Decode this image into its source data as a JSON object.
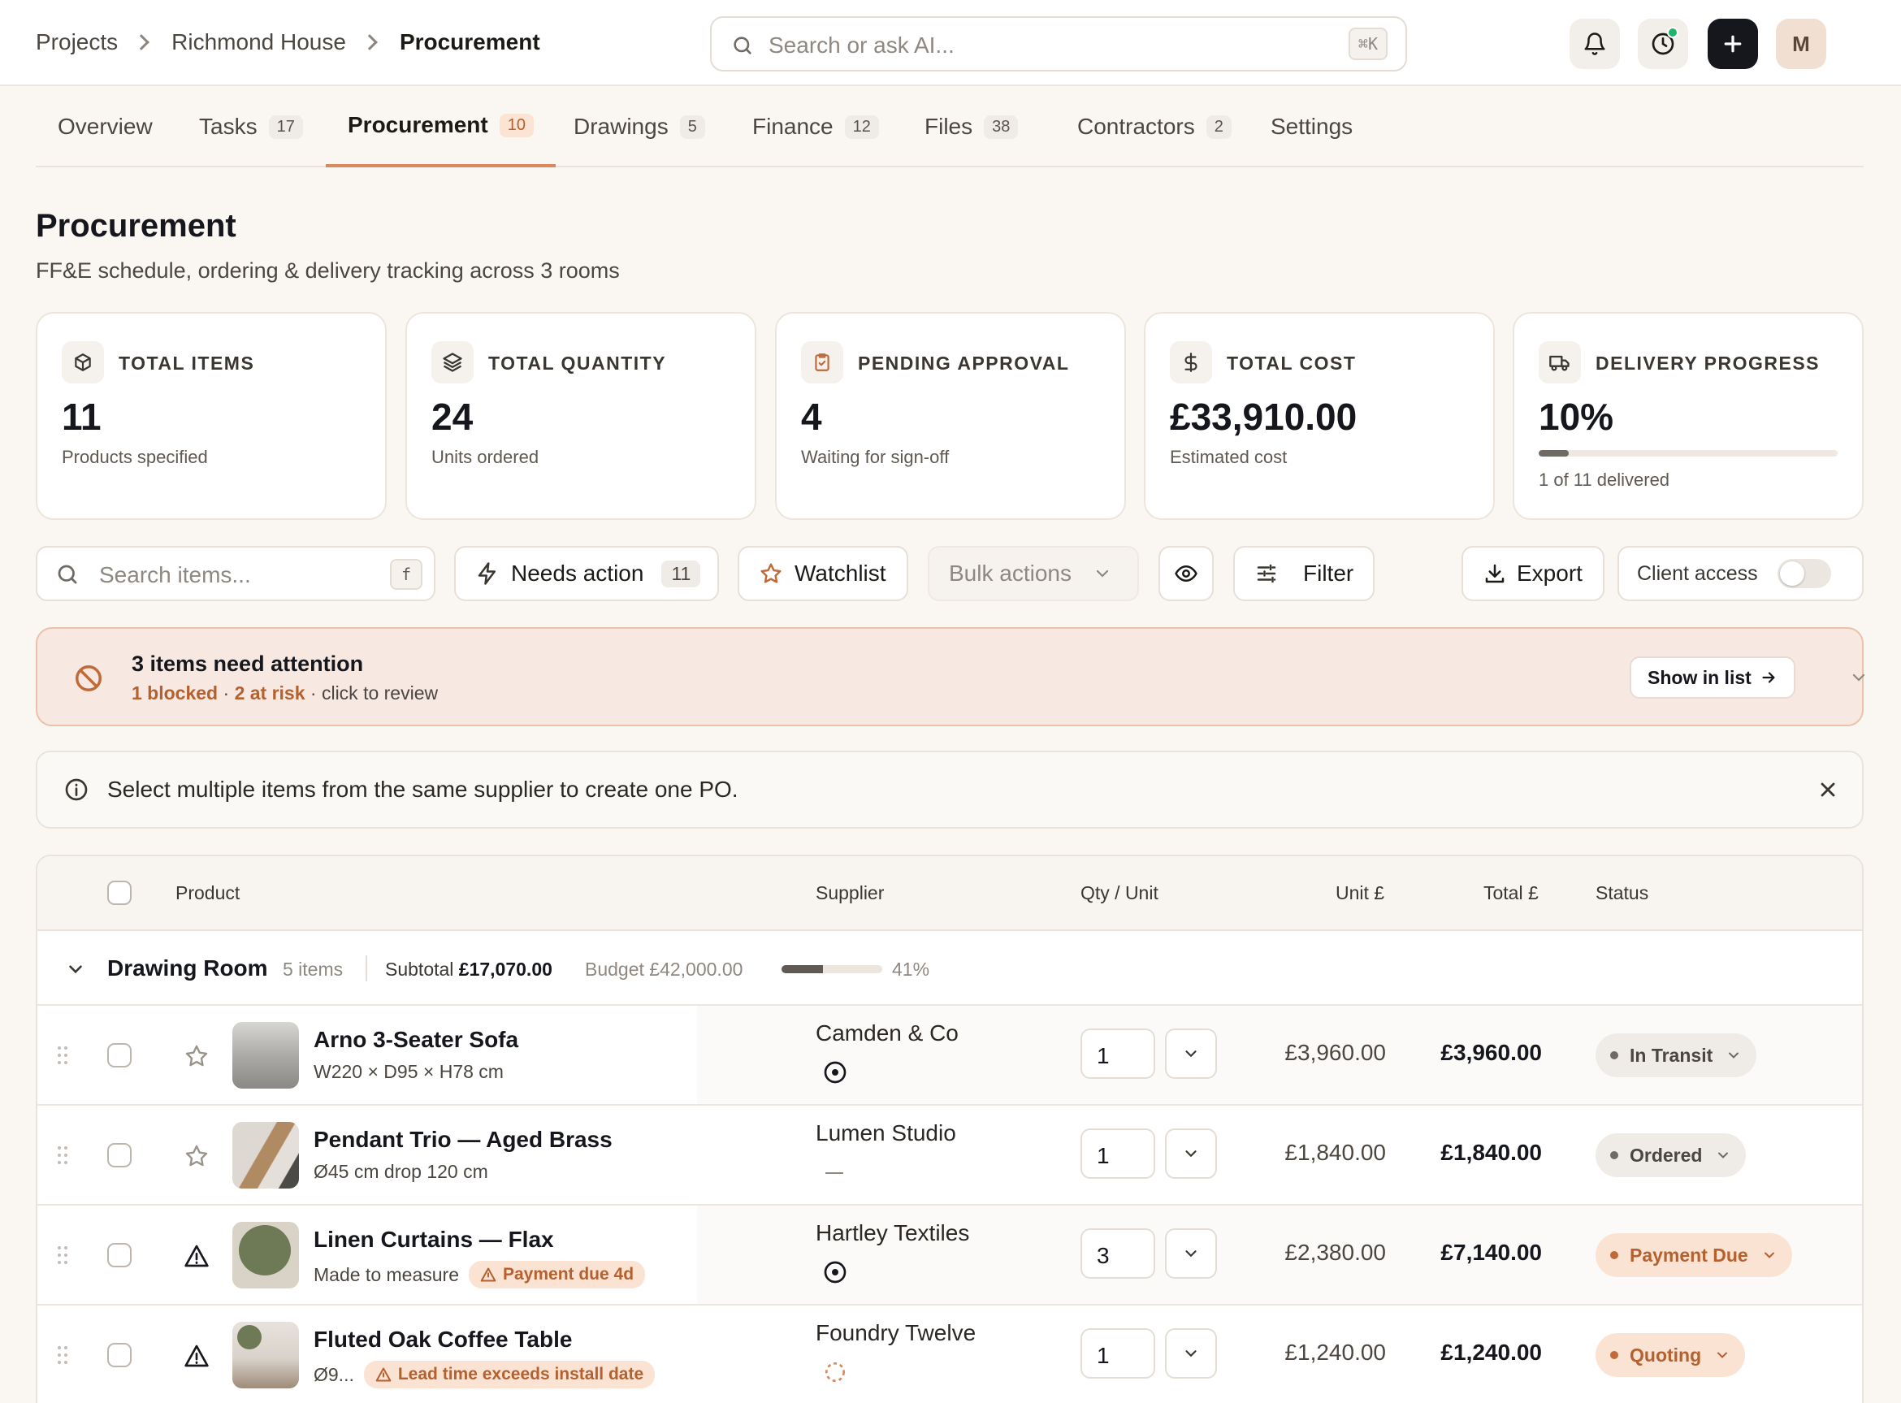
{
  "breadcrumbs": [
    "Projects",
    "Richmond House",
    "Procurement"
  ],
  "search": {
    "placeholder": "Search or ask AI...",
    "shortcut": "⌘K"
  },
  "user": {
    "initial": "M"
  },
  "tabs": [
    {
      "label": "Overview",
      "count": ""
    },
    {
      "label": "Tasks",
      "count": "17"
    },
    {
      "label": "Procurement",
      "count": "10"
    },
    {
      "label": "Drawings",
      "count": "5"
    },
    {
      "label": "Finance",
      "count": "12"
    },
    {
      "label": "Files",
      "count": "38"
    },
    {
      "label": "Contractors",
      "count": "2"
    },
    {
      "label": "Settings",
      "count": ""
    }
  ],
  "page": {
    "title": "Procurement",
    "subtitle": "FF&E schedule, ordering & delivery tracking across 3 rooms"
  },
  "kpis": [
    {
      "label": "TOTAL ITEMS",
      "value": "11",
      "sub": "Products specified",
      "icon": "package-icon"
    },
    {
      "label": "TOTAL QUANTITY",
      "value": "24",
      "sub": "Units ordered",
      "icon": "layers-icon"
    },
    {
      "label": "PENDING APPROVAL",
      "value": "4",
      "sub": "Waiting for sign-off",
      "icon": "clipboard-check-icon"
    },
    {
      "label": "TOTAL COST",
      "value": "£33,910.00",
      "sub": "Estimated cost",
      "icon": "dollar-icon"
    },
    {
      "label": "DELIVERY PROGRESS",
      "value": "10%",
      "sub": "1 of 11 delivered",
      "icon": "truck-icon",
      "progress": 0.1
    }
  ],
  "toolbar": {
    "search_placeholder": "Search items...",
    "search_shortcut": "f",
    "needs_action_label": "Needs action",
    "needs_action_count": "11",
    "watchlist_label": "Watchlist",
    "bulk_label": "Bulk actions",
    "filter_label": "Filter",
    "export_label": "Export",
    "client_access_label": "Client access",
    "client_access_on": false
  },
  "alert": {
    "title": "3 items need attention",
    "blocked": "1 blocked",
    "sep": "·",
    "at_risk": "2 at risk",
    "suffix": "· click to review",
    "button": "Show in list"
  },
  "info": {
    "text": "Select multiple items from the same supplier to create one PO."
  },
  "table": {
    "headers": {
      "product": "Product",
      "supplier": "Supplier",
      "qty": "Qty / Unit",
      "unit": "Unit £",
      "total": "Total £",
      "status": "Status"
    },
    "group": {
      "name": "Drawing Room",
      "items": "5 items",
      "subtotal_label": "Subtotal",
      "subtotal": "£17,070.00",
      "budget": "Budget £42,000.00",
      "pct_label": "41%",
      "pct": 0.41
    },
    "rows": [
      {
        "name": "Arno 3-Seater Sofa",
        "desc": "W220 × D95 × H78 cm",
        "warning": "",
        "supplier": "Camden & Co",
        "qty": "1",
        "unit": "£3,960.00",
        "total": "£3,960.00",
        "status": "In Transit",
        "status_kind": "neutral",
        "flag": "star"
      },
      {
        "name": "Pendant Trio — Aged Brass",
        "desc": "Ø45 cm drop 120 cm",
        "warning": "",
        "supplier": "Lumen Studio",
        "qty": "1",
        "unit": "£1,840.00",
        "total": "£1,840.00",
        "status": "Ordered",
        "status_kind": "neutral",
        "flag": "star"
      },
      {
        "name": "Linen Curtains — Flax",
        "desc": "Made to measure",
        "warning": "Payment due 4d",
        "supplier": "Hartley Textiles",
        "qty": "3",
        "unit": "£2,380.00",
        "total": "£7,140.00",
        "status": "Payment Due",
        "status_kind": "warn",
        "flag": "warning"
      },
      {
        "name": "Fluted Oak Coffee Table",
        "desc": "Ø9...",
        "warning": "Lead time exceeds install date",
        "supplier": "Foundry Twelve",
        "qty": "1",
        "unit": "£1,240.00",
        "total": "£1,240.00",
        "status": "Quoting",
        "status_kind": "warn",
        "flag": "warning"
      }
    ]
  },
  "colors": {
    "accent": "#d9895c",
    "warn_text": "#b4602f",
    "warn_bg": "#fbe3d3",
    "online": "#22b36a"
  }
}
